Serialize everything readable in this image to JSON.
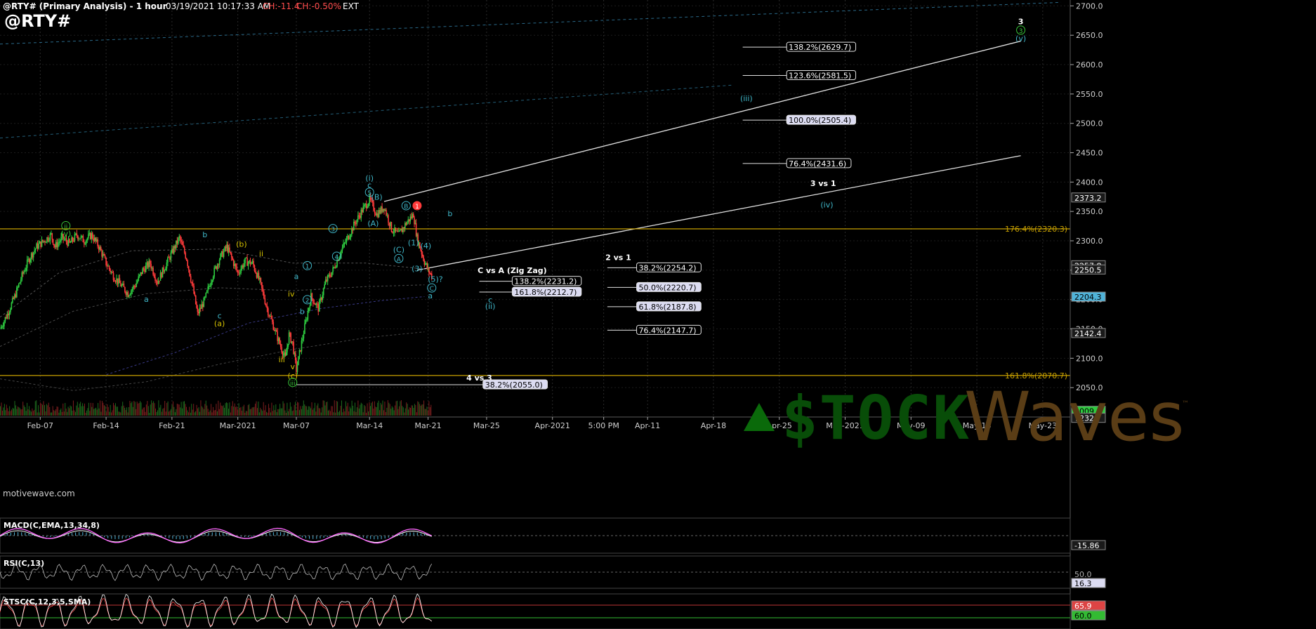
{
  "header": {
    "symbol_title": "@RTY# (Primary Analysis) - 1 hour",
    "datetime": "03/19/2021 10:17:33 AM",
    "change_points": "CH:-11.4",
    "change_percent": "CH:-0.50%",
    "session": "EXT",
    "big_symbol": "@RTY#"
  },
  "watermark": {
    "site": "motivewave.com",
    "logo_stock": "$TOCK",
    "logo_waves": "Waves",
    "logo_tm": "™"
  },
  "colors": {
    "background": "#000000",
    "grid": "#2a2a2a",
    "up_candle": "#2ecc40",
    "down_candle": "#ff3b3b",
    "yellow_line": "#c8a000",
    "cyan_label": "#3fb6c8",
    "green_label": "#39c839",
    "yellow_label": "#d4c000",
    "macd_line": "#ff66ff",
    "macd_signal": "#ffffff",
    "macd_hist": "#4fb3d9",
    "rsi_line": "#bdbdbd",
    "stoch_k": "#ffffff",
    "stoch_d": "#ff4d4d"
  },
  "chart_data": {
    "type": "candlestick",
    "timeframe": "1 hour",
    "price_axis": {
      "ylim": [
        2000,
        2710
      ],
      "ticks": [
        "2700.0",
        "2650.0",
        "2600.0",
        "2550.0",
        "2500.0",
        "2450.0",
        "2400.0",
        "2350.0",
        "2300.0",
        "2250.0",
        "2200.0",
        "2150.0",
        "2100.0",
        "2050.0"
      ],
      "tick_values": [
        2700,
        2650,
        2600,
        2550,
        2500,
        2450,
        2400,
        2350,
        2300,
        2250,
        2200,
        2150,
        2100,
        2050
      ]
    },
    "price_flags": [
      {
        "text": "2373.2",
        "value": 2373.2,
        "color": "#d8d8d8"
      },
      {
        "text": "2257.8",
        "value": 2257.8,
        "color": "#d8d8d8"
      },
      {
        "text": "2250.5",
        "value": 2250.5,
        "color": "#d8d8d8"
      },
      {
        "text": "2204.3",
        "value": 2204.3,
        "color": "#4fb3d9"
      },
      {
        "text": "2142.4",
        "value": 2142.4,
        "color": "#d8d8d8"
      },
      {
        "text": "2009.9",
        "value": 2009.9,
        "color": "#2ecc40"
      },
      {
        "text": "7232",
        "value": 1998,
        "color": "#d8d8d8"
      }
    ],
    "time_axis": {
      "xlim_days": [
        0,
        107
      ],
      "labels": [
        {
          "text": "Feb-07",
          "day": 5.5
        },
        {
          "text": "Feb-14",
          "day": 14.5
        },
        {
          "text": "Feb-21",
          "day": 23.5
        },
        {
          "text": "Mar-2021",
          "day": 32.5
        },
        {
          "text": "Mar-07",
          "day": 40.5
        },
        {
          "text": "Mar-14",
          "day": 50.5
        },
        {
          "text": "Mar-21",
          "day": 58.5
        },
        {
          "text": "Mar-25",
          "day": 66.5
        },
        {
          "text": "Apr-2021",
          "day": 75.5
        },
        {
          "text": "5:00 PM",
          "day": 82.5
        },
        {
          "text": "Apr-11",
          "day": 88.5
        },
        {
          "text": "Apr-18",
          "day": 97.5
        },
        {
          "text": "Apr-25",
          "day": 106.5
        },
        {
          "text": "May-2021",
          "day": 115.5
        },
        {
          "text": "May-09",
          "day": 124.5
        },
        {
          "text": "May-16",
          "day": 133.5
        },
        {
          "text": "May-23",
          "day": 142.5
        }
      ]
    },
    "price_path": [
      [
        0,
        2150
      ],
      [
        1,
        2175
      ],
      [
        2,
        2205
      ],
      [
        3,
        2240
      ],
      [
        4,
        2270
      ],
      [
        5,
        2290
      ],
      [
        6,
        2300
      ],
      [
        7,
        2310
      ],
      [
        7.5,
        2290
      ],
      [
        8.5,
        2305
      ],
      [
        9.5,
        2295
      ],
      [
        10.5,
        2310
      ],
      [
        11.5,
        2300
      ],
      [
        12.5,
        2310
      ],
      [
        13.5,
        2290
      ],
      [
        14.5,
        2262
      ],
      [
        15.5,
        2240
      ],
      [
        16.5,
        2225
      ],
      [
        17.5,
        2210
      ],
      [
        18.5,
        2225
      ],
      [
        19.5,
        2250
      ],
      [
        20.5,
        2262
      ],
      [
        21.5,
        2230
      ],
      [
        22.5,
        2255
      ],
      [
        23.5,
        2280
      ],
      [
        24.5,
        2305
      ],
      [
        25.5,
        2270
      ],
      [
        26.5,
        2210
      ],
      [
        27,
        2175
      ],
      [
        28,
        2200
      ],
      [
        29,
        2240
      ],
      [
        30,
        2270
      ],
      [
        31,
        2290
      ],
      [
        31.5,
        2275
      ],
      [
        32.5,
        2245
      ],
      [
        33.5,
        2265
      ],
      [
        34.5,
        2262
      ],
      [
        35.5,
        2230
      ],
      [
        36.5,
        2185
      ],
      [
        37.5,
        2150
      ],
      [
        38.5,
        2115
      ],
      [
        39,
        2100
      ],
      [
        39.5,
        2140
      ],
      [
        40,
        2125
      ],
      [
        40.5,
        2080
      ],
      [
        41.5,
        2145
      ],
      [
        42.5,
        2205
      ],
      [
        43.5,
        2185
      ],
      [
        44.5,
        2230
      ],
      [
        45.5,
        2250
      ],
      [
        46.5,
        2280
      ],
      [
        47.5,
        2305
      ],
      [
        48.5,
        2330
      ],
      [
        49.5,
        2352
      ],
      [
        50.5,
        2370
      ],
      [
        51.5,
        2345
      ],
      [
        52.5,
        2358
      ],
      [
        53.5,
        2320
      ],
      [
        54.5,
        2310
      ],
      [
        55.5,
        2330
      ],
      [
        56.5,
        2345
      ],
      [
        57,
        2305
      ],
      [
        57.5,
        2285
      ],
      [
        58,
        2265
      ],
      [
        58.5,
        2250
      ],
      [
        59,
        2240
      ]
    ],
    "moving_averages": [
      {
        "name": "ma1",
        "color": "#555555",
        "points": [
          [
            0,
            2170
          ],
          [
            8,
            2245
          ],
          [
            18,
            2283
          ],
          [
            30,
            2286
          ],
          [
            40,
            2262
          ],
          [
            50,
            2262
          ],
          [
            58,
            2252
          ]
        ]
      },
      {
        "name": "ma2",
        "color": "#4a4a4a",
        "points": [
          [
            0,
            2120
          ],
          [
            10,
            2180
          ],
          [
            20,
            2210
          ],
          [
            30,
            2220
          ],
          [
            40,
            2215
          ],
          [
            50,
            2222
          ],
          [
            58,
            2225
          ]
        ]
      },
      {
        "name": "ma3",
        "color": "#3a3a88",
        "points": [
          [
            14,
            2070
          ],
          [
            24,
            2110
          ],
          [
            34,
            2160
          ],
          [
            44,
            2185
          ],
          [
            52,
            2198
          ],
          [
            58,
            2205
          ]
        ]
      },
      {
        "name": "ma4",
        "color": "#444444",
        "points": [
          [
            0,
            2065
          ],
          [
            10,
            2045
          ],
          [
            20,
            2060
          ],
          [
            30,
            2090
          ],
          [
            40,
            2115
          ],
          [
            50,
            2135
          ],
          [
            58,
            2145
          ]
        ]
      }
    ],
    "horizontal_lines": [
      {
        "label": "176.4%(2320.3)",
        "value": 2320.3,
        "color": "#c8a000"
      },
      {
        "label": "161.8%(2070.7)",
        "value": 2070.7,
        "color": "#c8a000"
      }
    ],
    "trend_lines": [
      {
        "from": [
          52.5,
          2367
        ],
        "to": [
          139.5,
          2640
        ],
        "color": "#e0e0e0"
      },
      {
        "from": [
          57,
          2250
        ],
        "to": [
          139.5,
          2445
        ],
        "color": "#e0e0e0"
      },
      {
        "from": [
          0,
          2635
        ],
        "to": [
          145,
          2706
        ],
        "color": "#2a6a8a"
      },
      {
        "from": [
          0,
          2475
        ],
        "to": [
          100,
          2565
        ],
        "color": "#235e78"
      }
    ],
    "fib_groups": [
      {
        "title": "3 vs 1",
        "title_anchor": [
          112.5,
          2393
        ],
        "x_start": 101.5,
        "x_end": 107.5,
        "levels": [
          {
            "label": "138.2%(2629.7)",
            "value": 2629.7
          },
          {
            "label": "123.6%(2581.5)",
            "value": 2581.5
          },
          {
            "label": "100.0%(2505.4)",
            "value": 2505.4
          },
          {
            "label": "76.4%(2431.6)",
            "value": 2431.6
          }
        ]
      },
      {
        "title": "2 vs 1",
        "title_anchor": [
          84.5,
          2267
        ],
        "x_start": 83,
        "x_end": 87,
        "levels": [
          {
            "label": "38.2%(2254.2)",
            "value": 2254.2
          },
          {
            "label": "50.0%(2220.7)",
            "value": 2220.7
          },
          {
            "label": "61.8%(2187.8)",
            "value": 2187.8
          },
          {
            "label": "76.4%(2147.7)",
            "value": 2147.7
          }
        ]
      },
      {
        "title": "C vs A (Zig Zag)",
        "title_anchor": [
          70,
          2245
        ],
        "x_start": 65.5,
        "x_end": 70,
        "levels": [
          {
            "label": "138.2%(2231.2)",
            "value": 2231.2
          },
          {
            "label": "161.8%(2212.7)",
            "value": 2212.7
          }
        ]
      },
      {
        "title": "4 vs 3",
        "title_anchor": [
          65.5,
          2062
        ],
        "x_start": 40.5,
        "x_end": 66,
        "levels": [
          {
            "label": "38.2%(2055.0)",
            "value": 2055.0
          }
        ]
      }
    ],
    "wave_labels": [
      {
        "text": "3",
        "day": 139.5,
        "price": 2669,
        "color": "#ffffff",
        "bold": true
      },
      {
        "text": "3",
        "day": 139.5,
        "price": 2654,
        "color": "#39c839",
        "circle": true
      },
      {
        "text": "(v)",
        "day": 139.5,
        "price": 2640,
        "color": "#3fb6c8"
      },
      {
        "text": "(iii)",
        "day": 102,
        "price": 2538,
        "color": "#3fb6c8"
      },
      {
        "text": "(iv)",
        "day": 113,
        "price": 2357,
        "color": "#3fb6c8"
      },
      {
        "text": "(i)",
        "day": 50.5,
        "price": 2402,
        "color": "#3fb6c8"
      },
      {
        "text": "c",
        "day": 50.5,
        "price": 2390,
        "color": "#3fb6c8"
      },
      {
        "text": "5",
        "day": 50.5,
        "price": 2378,
        "color": "#3fb6c8",
        "circle": true
      },
      {
        "text": "(B)",
        "day": 51.5,
        "price": 2370,
        "color": "#3fb6c8"
      },
      {
        "text": "(A)",
        "day": 51,
        "price": 2325,
        "color": "#3fb6c8"
      },
      {
        "text": "B",
        "day": 55.5,
        "price": 2355,
        "color": "#3fb6c8",
        "circle": true
      },
      {
        "text": "1",
        "day": 57,
        "price": 2355,
        "color": "#ff3b3b",
        "circle": true,
        "filled": true
      },
      {
        "text": "b",
        "day": 61.5,
        "price": 2342,
        "color": "#3fb6c8"
      },
      {
        "text": "(C)",
        "day": 54.5,
        "price": 2280,
        "color": "#3fb6c8"
      },
      {
        "text": "A",
        "day": 54.5,
        "price": 2265,
        "color": "#3fb6c8",
        "circle": true
      },
      {
        "text": "(1)",
        "day": 56.5,
        "price": 2292,
        "color": "#3fb6c8"
      },
      {
        "text": "(4)",
        "day": 58.2,
        "price": 2287,
        "color": "#3fb6c8"
      },
      {
        "text": "(3)",
        "day": 57,
        "price": 2248,
        "color": "#3fb6c8"
      },
      {
        "text": "(5)?",
        "day": 59.5,
        "price": 2230,
        "color": "#3fb6c8"
      },
      {
        "text": "C",
        "day": 59,
        "price": 2215,
        "color": "#3fb6c8",
        "circle": true
      },
      {
        "text": "a",
        "day": 58.8,
        "price": 2202,
        "color": "#3fb6c8"
      },
      {
        "text": "c",
        "day": 67,
        "price": 2195,
        "color": "#3fb6c8"
      },
      {
        "text": "(ii)",
        "day": 67,
        "price": 2184,
        "color": "#3fb6c8"
      },
      {
        "text": "ii",
        "day": 9,
        "price": 2321,
        "color": "#39c839",
        "circle": true
      },
      {
        "text": "(v)",
        "day": 9,
        "price": 2308,
        "color": "#39c839"
      },
      {
        "text": "b",
        "day": 28,
        "price": 2306,
        "color": "#3fb6c8"
      },
      {
        "text": "a",
        "day": 20,
        "price": 2196,
        "color": "#3fb6c8"
      },
      {
        "text": "c",
        "day": 30,
        "price": 2168,
        "color": "#3fb6c8"
      },
      {
        "text": "(a)",
        "day": 30,
        "price": 2155,
        "color": "#d4c000"
      },
      {
        "text": "(b)",
        "day": 33,
        "price": 2290,
        "color": "#d4c000"
      },
      {
        "text": "ii",
        "day": 35.7,
        "price": 2274,
        "color": "#d4c000"
      },
      {
        "text": "a",
        "day": 40.5,
        "price": 2235,
        "color": "#3fb6c8"
      },
      {
        "text": "iv",
        "day": 39.8,
        "price": 2205,
        "color": "#d4c000"
      },
      {
        "text": "iii",
        "day": 38.5,
        "price": 2093,
        "color": "#d4c000"
      },
      {
        "text": "v",
        "day": 40,
        "price": 2081,
        "color": "#d4c000"
      },
      {
        "text": "(c)",
        "day": 40,
        "price": 2066,
        "color": "#d4c000"
      },
      {
        "text": "iii",
        "day": 40,
        "price": 2054,
        "color": "#39c839",
        "circle": true
      },
      {
        "text": "1",
        "day": 42,
        "price": 2253,
        "color": "#3fb6c8",
        "circle": true
      },
      {
        "text": "2",
        "day": 42,
        "price": 2195,
        "color": "#3fb6c8",
        "circle": true
      },
      {
        "text": "b",
        "day": 41.3,
        "price": 2175,
        "color": "#3fb6c8"
      },
      {
        "text": "3",
        "day": 45.5,
        "price": 2316,
        "color": "#3fb6c8",
        "circle": true
      },
      {
        "text": "4",
        "day": 46,
        "price": 2269,
        "color": "#3fb6c8",
        "circle": true
      }
    ],
    "macd": {
      "title": "MACD(C,EMA,13,34,8)",
      "last_value": "-15.86"
    },
    "rsi": {
      "title": "RSI(C,13)",
      "level_label": "50.0",
      "last_value": "16.3"
    },
    "stochastic": {
      "title": "STSC(C,12,3,5,SMA)",
      "upper_value": "65.9",
      "lower_value": "60.0"
    }
  }
}
